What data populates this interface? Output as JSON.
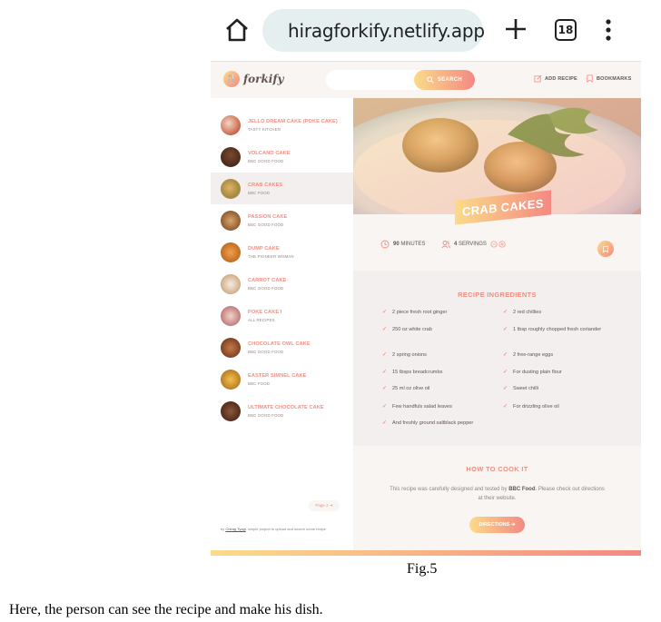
{
  "browser": {
    "url": "hiragforkify.netlify.app",
    "tab_count": "18"
  },
  "app": {
    "logo_text": "forkify",
    "search_label": "SEARCH",
    "nav": {
      "add_recipe": "ADD RECIPE",
      "bookmarks": "BOOKMARKS"
    }
  },
  "results": [
    {
      "title": "JELLO DREAM CAKE (POKE CAKE)",
      "publisher": "TASTY KITCHEN"
    },
    {
      "title": "VOLCANO CAKE",
      "publisher": "BBC GOOD FOOD"
    },
    {
      "title": "CRAB CAKES",
      "publisher": "BBC FOOD"
    },
    {
      "title": "PASSION CAKE",
      "publisher": "BBC GOOD FOOD"
    },
    {
      "title": "DUMP CAKE",
      "publisher": "THE PIONEER WOMAN"
    },
    {
      "title": "CARROT CAKE",
      "publisher": "BBC GOOD FOOD"
    },
    {
      "title": "POKE CAKE I",
      "publisher": "ALL RECIPES"
    },
    {
      "title": "CHOCOLATE OWL CAKE",
      "publisher": "BBC GOOD FOOD"
    },
    {
      "title": "EASTER SIMNEL CAKE",
      "publisher": "BBC FOOD"
    },
    {
      "title": "ULTIMATE CHOCOLATE CAKE",
      "publisher": "BBC GOOD FOOD"
    }
  ],
  "pagination": {
    "next": "Page 2 ➔"
  },
  "copyright": {
    "prefix": "by ",
    "author": "Chirag Tyagi",
    "suffix": ". simple project to upload and search some recipe"
  },
  "recipe": {
    "title": "CRAB CAKES",
    "minutes": "90",
    "minutes_label": "MINUTES",
    "servings": "4",
    "servings_label": "SERVINGS",
    "ingredients_heading": "RECIPE INGREDIENTS",
    "ingredients_left": [
      "2 piece fresh root ginger",
      "250 oz white crab",
      "2 spring onions",
      "15 tbsps breadcrumbs",
      "25 ml oz olive oil",
      "Few handfuls salad leaves",
      "And freshly ground saltblack pepper"
    ],
    "ingredients_right": [
      "2 red chillies",
      "1 tbsp roughly chopped fresh coriander",
      "2 free-range eggs",
      "For dusting plain flour",
      "Sweet chilli",
      "For drizzling olive oil"
    ],
    "cook_heading": "HOW TO COOK IT",
    "cook_text_prefix": "This recipe was carefully designed and tested by ",
    "cook_publisher": "BBC Food",
    "cook_text_suffix": ". Please check out directions at their website.",
    "directions_label": "DIRECTIONS ➔"
  },
  "caption": "Fig.5",
  "paragraph": "Here, the person can see the recipe and make his dish.",
  "colors": {
    "accent_start": "#fbdb89",
    "accent_end": "#f48982",
    "text": "#615551"
  }
}
